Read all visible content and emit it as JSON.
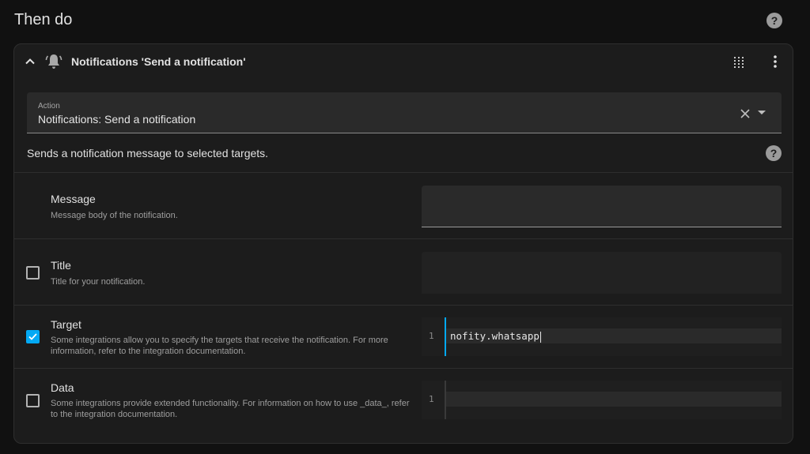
{
  "header": {
    "title": "Then do",
    "help_icon": "help-circle-icon",
    "help_glyph": "?"
  },
  "card": {
    "title": "Notifications 'Send a notification'",
    "icons": [
      "chevron-up-icon",
      "bell-ring-icon",
      "drag-handle-icon",
      "more-vertical-icon"
    ],
    "action": {
      "label": "Action",
      "value": "Notifications: Send a notification"
    },
    "description": "Sends a notification message to selected targets.",
    "fields": {
      "message": {
        "label": "Message",
        "help": "Message body of the notification.",
        "value": ""
      },
      "title": {
        "label": "Title",
        "help": "Title for your notification.",
        "checked": false,
        "value": ""
      },
      "target": {
        "label": "Target",
        "help": "Some integrations allow you to specify the targets that receive the notification. For more information, refer to the integration documentation.",
        "checked": true,
        "line_number": "1",
        "code": "nofity.whatsapp"
      },
      "data": {
        "label": "Data",
        "help": "Some integrations provide extended functionality. For information on how to use _data_, refer to the integration documentation.",
        "checked": false,
        "line_number": "1",
        "code": ""
      }
    }
  },
  "colors": {
    "accent": "#03a9f4",
    "background": "#111111",
    "card": "#1c1c1c"
  }
}
